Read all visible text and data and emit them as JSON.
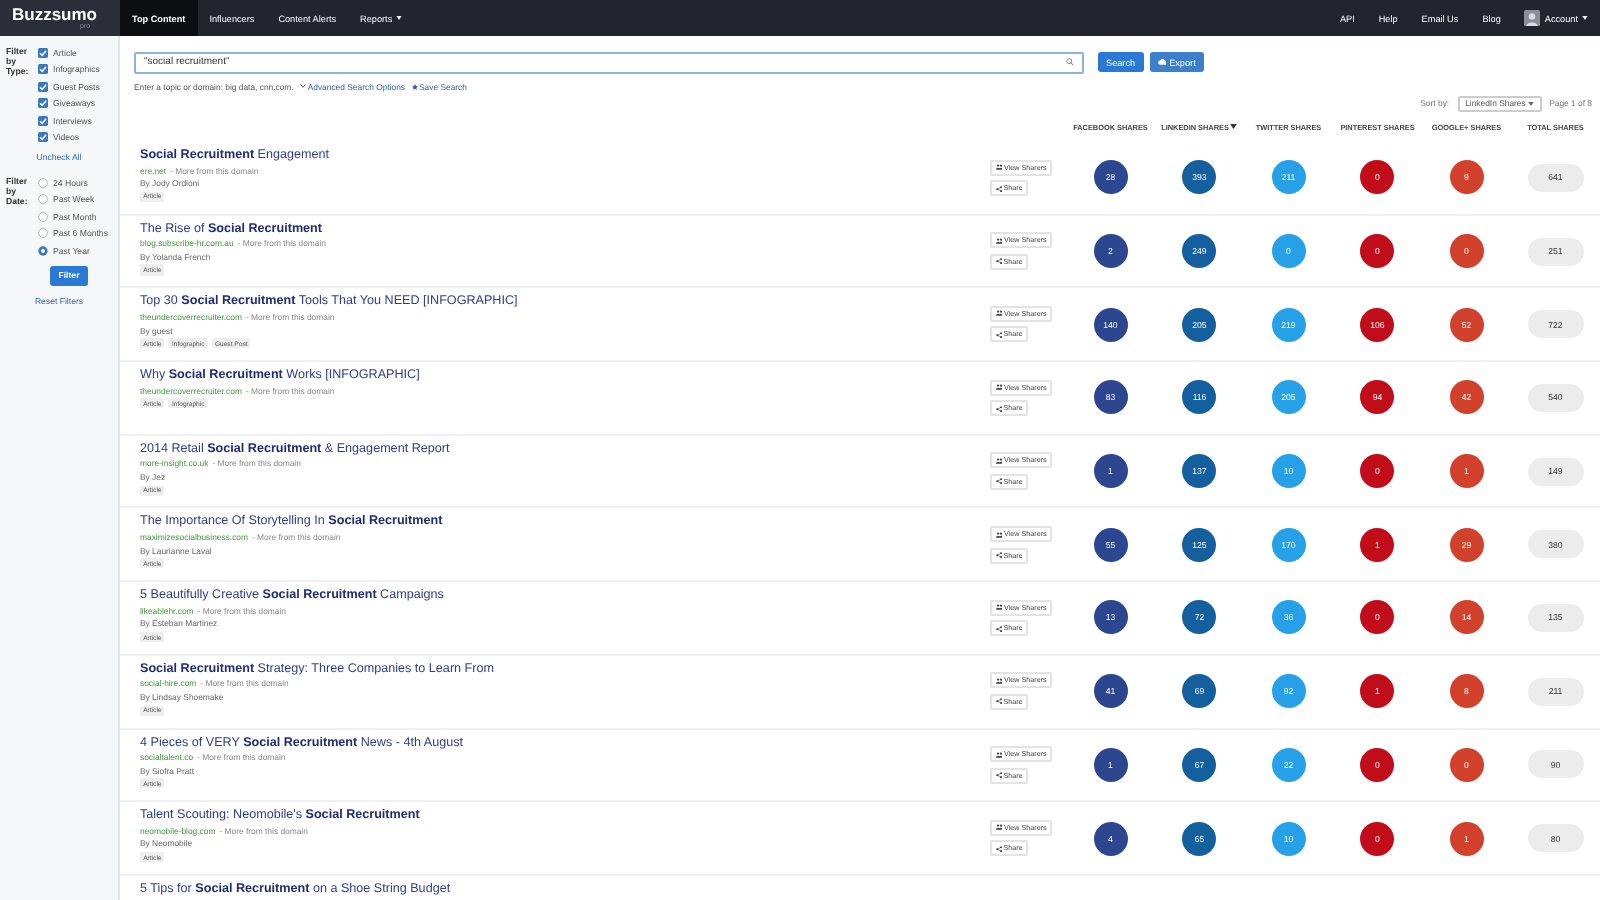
{
  "header": {
    "logo": "Buzzsumo",
    "logo_badge": "pro",
    "nav": [
      {
        "label": "Top Content",
        "selected": true,
        "dropdown": false
      },
      {
        "label": "Influencers",
        "selected": false,
        "dropdown": false
      },
      {
        "label": "Content Alerts",
        "selected": false,
        "dropdown": false
      },
      {
        "label": "Reports",
        "selected": false,
        "dropdown": true
      }
    ],
    "links": [
      "API",
      "Help",
      "Email Us",
      "Blog"
    ],
    "account": "Account"
  },
  "sidebar": {
    "type_filter": {
      "label": "Filter by Type:",
      "options": [
        {
          "label": "Article",
          "checked": true
        },
        {
          "label": "Infographics",
          "checked": true
        },
        {
          "label": "Guest Posts",
          "checked": true
        },
        {
          "label": "Giveaways",
          "checked": true
        },
        {
          "label": "Interviews",
          "checked": true
        },
        {
          "label": "Videos",
          "checked": true
        }
      ],
      "uncheck_all": "Uncheck All"
    },
    "date_filter": {
      "label": "Filter by Date:",
      "options": [
        {
          "label": "24 Hours",
          "selected": false
        },
        {
          "label": "Past Week",
          "selected": false
        },
        {
          "label": "Past Month",
          "selected": false
        },
        {
          "label": "Past 6 Months",
          "selected": false
        },
        {
          "label": "Past Year",
          "selected": true
        }
      ]
    },
    "filter_button": "Filter",
    "reset": "Reset Filters"
  },
  "search": {
    "value": "\"social recruitment\"",
    "search_button": "Search",
    "export_button": "Export",
    "hint": "Enter a topic or domain: big data, cnn.com.",
    "advanced": "Advanced Search Options",
    "save": "Save Search"
  },
  "sort": {
    "label": "Sort by:",
    "value": "LinkedIn Shares",
    "page": "Page 1 of 8"
  },
  "columns": [
    {
      "label": "FACEBOOK SHARES",
      "kind": "facebook",
      "sorted": false
    },
    {
      "label": "LINKEDIN SHARES",
      "kind": "linkedin",
      "sorted": true
    },
    {
      "label": "TWITTER SHARES",
      "kind": "twitter",
      "sorted": false
    },
    {
      "label": "PINTEREST SHARES",
      "kind": "pinterest",
      "sorted": false
    },
    {
      "label": "GOOGLE+ SHARES",
      "kind": "googleplus",
      "sorted": false
    },
    {
      "label": "TOTAL SHARES",
      "kind": "total",
      "sorted": false
    }
  ],
  "results": [
    {
      "title": "**Social Recruitment** Engagement",
      "domain": "ere.net",
      "more": "- More from this domain",
      "author": "By Jody Ordioni",
      "tags": [
        "Article"
      ],
      "view": "View Sharers",
      "share": "Share",
      "shares": [
        "28",
        "393",
        "211",
        "0",
        "9",
        "641"
      ]
    },
    {
      "title": "The Rise of **Social Recruitment**",
      "domain": "blog.subscribe-hr.com.au",
      "more": "- More from this domain",
      "author": "By Yolanda French",
      "tags": [
        "Article"
      ],
      "view": "View Sharers",
      "share": "Share",
      "shares": [
        "2",
        "249",
        "0",
        "0",
        "0",
        "251"
      ]
    },
    {
      "title": "Top 30 **Social Recruitment** Tools That You NEED [INFOGRAPHIC]",
      "domain": "theundercoverrecruiter.com",
      "more": "- More from this domain",
      "author": "By guest",
      "tags": [
        "Article",
        "Infographic",
        "Guest Post"
      ],
      "view": "View Sharers",
      "share": "Share",
      "shares": [
        "140",
        "205",
        "219",
        "106",
        "52",
        "722"
      ]
    },
    {
      "title": "Why **Social Recruitment** Works [INFOGRAPHIC]",
      "domain": "theundercoverrecruiter.com",
      "more": "- More from this domain",
      "tags": [
        "Article",
        "Infographic"
      ],
      "view": "View Sharers",
      "share": "Share",
      "shares": [
        "83",
        "116",
        "205",
        "94",
        "42",
        "540"
      ]
    },
    {
      "title": "2014 Retail **Social Recruitment** & Engagement Report",
      "domain": "more-insight.co.uk",
      "more": "- More from this domain",
      "author": "By Jez",
      "tags": [
        "Article"
      ],
      "view": "View Sharers",
      "share": "Share",
      "shares": [
        "1",
        "137",
        "10",
        "0",
        "1",
        "149"
      ]
    },
    {
      "title": "The Importance Of Storytelling In **Social Recruitment**",
      "domain": "maximizesocialbusiness.com",
      "more": "- More from this domain",
      "author": "By Laurianne Laval",
      "tags": [
        "Article"
      ],
      "view": "View Sharers",
      "share": "Share",
      "shares": [
        "55",
        "125",
        "170",
        "1",
        "29",
        "380"
      ]
    },
    {
      "title": "5 Beautifully Creative **Social Recruitment** Campaigns",
      "domain": "likeablehr.com",
      "more": "- More from this domain",
      "author": "By Esteban Martinez",
      "tags": [
        "Article"
      ],
      "view": "View Sharers",
      "share": "Share",
      "shares": [
        "13",
        "72",
        "36",
        "0",
        "14",
        "135"
      ]
    },
    {
      "title": "**Social Recruitment** Strategy: Three Companies to Learn From",
      "domain": "social-hire.com",
      "more": "- More from this domain",
      "author": "By Lindsay Shoemake",
      "tags": [
        "Article"
      ],
      "view": "View Sharers",
      "share": "Share",
      "shares": [
        "41",
        "69",
        "92",
        "1",
        "8",
        "211"
      ]
    },
    {
      "title": "4 Pieces of VERY **Social Recruitment** News - 4th August",
      "domain": "socialtalent.co",
      "more": "- More from this domain",
      "author": "By Siofra Pratt",
      "tags": [
        "Article"
      ],
      "view": "View Sharers",
      "share": "Share",
      "shares": [
        "1",
        "67",
        "22",
        "0",
        "0",
        "90"
      ]
    },
    {
      "title": "Talent Scouting: Neomobile's **Social Recruitment**",
      "domain": "neomobile-blog.com",
      "more": "- More from this domain",
      "author": "By Neomobile",
      "tags": [
        "Article"
      ],
      "view": "View Sharers",
      "share": "Share",
      "shares": [
        "4",
        "65",
        "10",
        "0",
        "1",
        "80"
      ]
    },
    {
      "title": "5 Tips for **Social Recruitment** on a Shoe String Budget"
    }
  ]
}
